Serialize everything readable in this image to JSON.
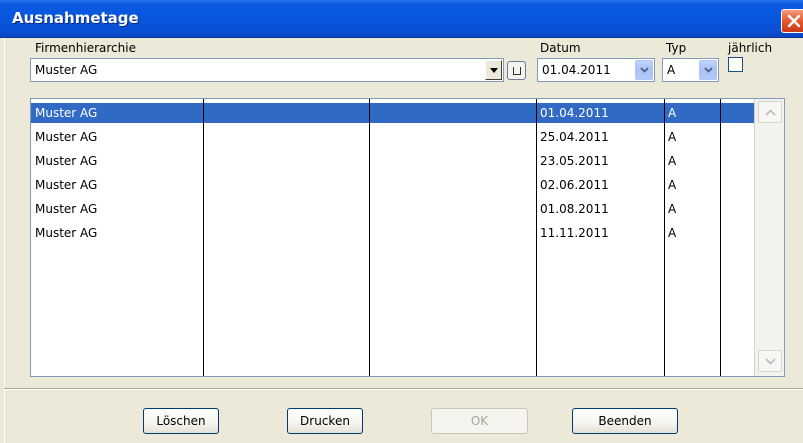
{
  "window": {
    "title": "Ausnahmetage"
  },
  "labels": {
    "hierarchy": "Firmenhierarchie",
    "date": "Datum",
    "type": "Typ",
    "yearly": "jährlich"
  },
  "filters": {
    "hierarchy_value": "Muster AG",
    "date_value": "01.04.2011",
    "type_value": "A",
    "yearly_checked": false
  },
  "list": {
    "rows": [
      {
        "name": "Muster AG",
        "date": "01.04.2011",
        "type": "A",
        "selected": true
      },
      {
        "name": "Muster AG",
        "date": "25.04.2011",
        "type": "A",
        "selected": false
      },
      {
        "name": "Muster AG",
        "date": "23.05.2011",
        "type": "A",
        "selected": false
      },
      {
        "name": "Muster AG",
        "date": "02.06.2011",
        "type": "A",
        "selected": false
      },
      {
        "name": "Muster AG",
        "date": "01.08.2011",
        "type": "A",
        "selected": false
      },
      {
        "name": "Muster AG",
        "date": "11.11.2011",
        "type": "A",
        "selected": false
      }
    ]
  },
  "buttons": {
    "delete": "Löschen",
    "print": "Drucken",
    "ok": "OK",
    "close": "Beenden"
  },
  "icons": {
    "close": "close-icon",
    "combo_dropdown": "dropdown-arrow-icon",
    "browse": "browse-icon",
    "scroll_up": "scroll-up-icon",
    "scroll_down": "scroll-down-icon"
  },
  "colors": {
    "titlebar": "#0855dd",
    "selection": "#316ac5",
    "face": "#ece9d8"
  }
}
